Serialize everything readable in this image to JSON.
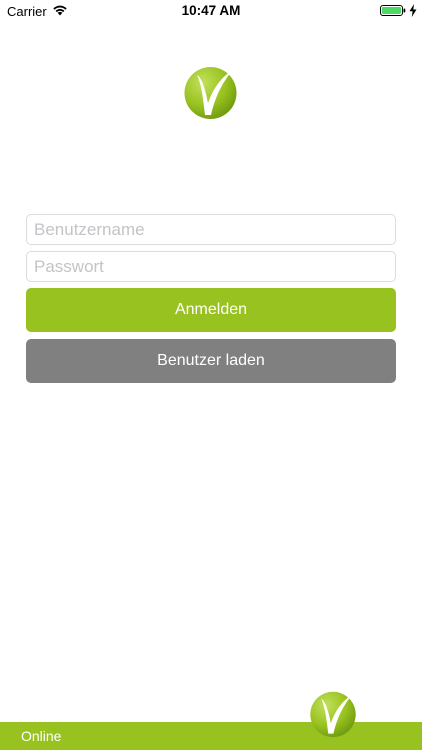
{
  "status_bar": {
    "carrier": "Carrier",
    "time": "10:47 AM",
    "battery_icon": "battery-full-icon",
    "wifi_icon": "wifi-icon",
    "charging_icon": "charging-bolt-icon"
  },
  "login": {
    "username_placeholder": "Benutzername",
    "password_placeholder": "Passwort",
    "login_button": "Anmelden",
    "load_user_button": "Benutzer laden"
  },
  "footer": {
    "connection_status": "Online"
  },
  "colors": {
    "brand_green": "#98c21f",
    "secondary_gray": "#808080"
  }
}
